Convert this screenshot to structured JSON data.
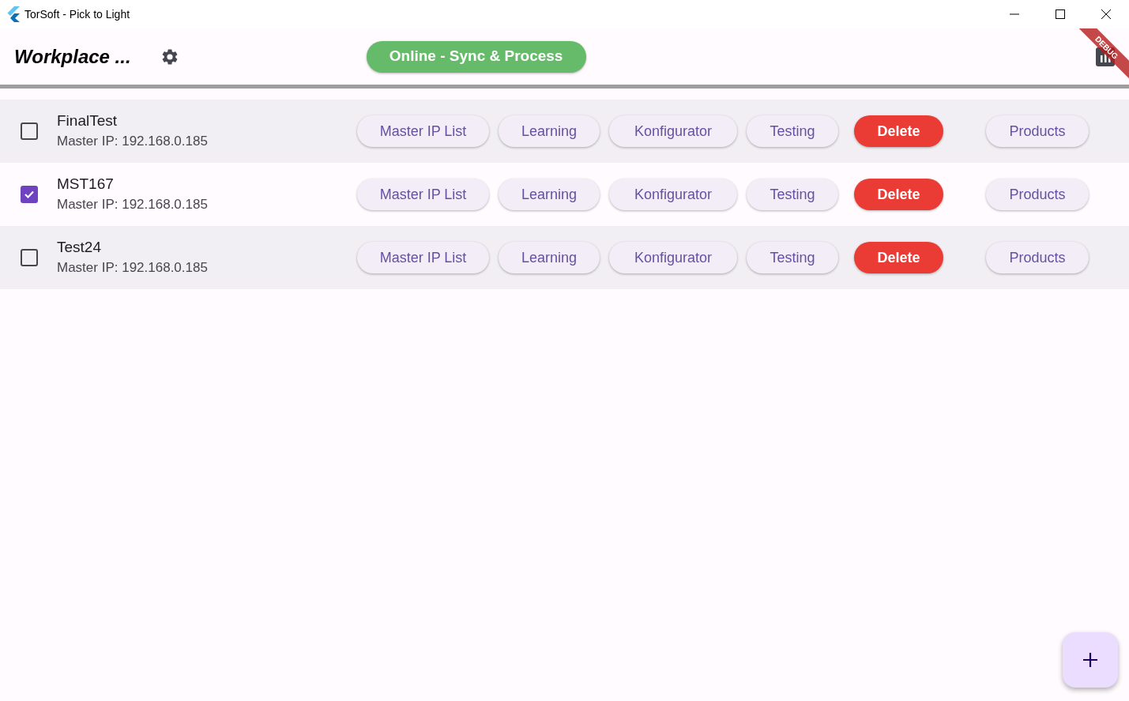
{
  "window": {
    "title": "TorSoft - Pick to Light"
  },
  "app_bar": {
    "title": "Workplace ...",
    "status_button": "Online - Sync & Process",
    "debug_banner": "DEBUG"
  },
  "rows": [
    {
      "name": "FinalTest",
      "subtitle": "Master IP: 192.168.0.185",
      "checked": false,
      "actions": [
        {
          "label": "Master IP List",
          "kind": "tonal"
        },
        {
          "label": "Learning",
          "kind": "tonal"
        },
        {
          "label": "Konfigurator",
          "kind": "tonal"
        },
        {
          "label": "Testing",
          "kind": "tonal"
        },
        {
          "label": "Delete",
          "kind": "danger"
        }
      ],
      "products_button": "Products"
    },
    {
      "name": "MST167",
      "subtitle": "Master IP: 192.168.0.185",
      "checked": true,
      "actions": [
        {
          "label": "Master IP List",
          "kind": "tonal"
        },
        {
          "label": "Learning",
          "kind": "tonal"
        },
        {
          "label": "Konfigurator",
          "kind": "tonal"
        },
        {
          "label": "Testing",
          "kind": "tonal"
        },
        {
          "label": "Delete",
          "kind": "danger"
        }
      ],
      "products_button": "Products"
    },
    {
      "name": "Test24",
      "subtitle": "Master IP: 192.168.0.185",
      "checked": false,
      "actions": [
        {
          "label": "Master IP List",
          "kind": "tonal"
        },
        {
          "label": "Learning",
          "kind": "tonal"
        },
        {
          "label": "Konfigurator",
          "kind": "tonal"
        },
        {
          "label": "Testing",
          "kind": "tonal"
        },
        {
          "label": "Delete",
          "kind": "danger"
        }
      ],
      "products_button": "Products"
    }
  ]
}
